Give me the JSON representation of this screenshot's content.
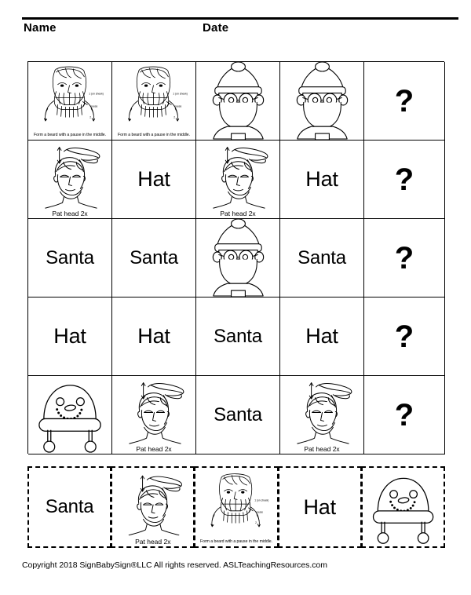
{
  "header": {
    "name_label": "Name",
    "date_label": "Date"
  },
  "icons": {
    "santa_sign": "santa-sign-illustration",
    "hat_sign": "hat-sign-illustration",
    "santa_picture": "santa-face-picture",
    "hat_picture": "hat-picture",
    "question": "question-mark"
  },
  "captions": {
    "santa_sign": "Form a beard with a pause in the middle.",
    "hat_sign": "Pat head 2x",
    "santa_sign_marks": {
      "one": "1 (on cheek)",
      "pause": "pause",
      "two": "2"
    }
  },
  "words": {
    "santa": "Santa",
    "hat": "Hat",
    "question": "?"
  },
  "grid": {
    "columns": 5,
    "rows": 5,
    "cells": [
      [
        {
          "type": "santa_sign",
          "text": ""
        },
        {
          "type": "santa_sign",
          "text": ""
        },
        {
          "type": "santa_picture",
          "text": ""
        },
        {
          "type": "santa_picture",
          "text": ""
        },
        {
          "type": "question",
          "text": "?"
        }
      ],
      [
        {
          "type": "hat_sign",
          "text": ""
        },
        {
          "type": "word",
          "text": "Hat"
        },
        {
          "type": "hat_sign",
          "text": ""
        },
        {
          "type": "word",
          "text": "Hat"
        },
        {
          "type": "question",
          "text": "?"
        }
      ],
      [
        {
          "type": "word",
          "text": "Santa"
        },
        {
          "type": "word",
          "text": "Santa"
        },
        {
          "type": "santa_picture",
          "text": ""
        },
        {
          "type": "word",
          "text": "Santa"
        },
        {
          "type": "question",
          "text": "?"
        }
      ],
      [
        {
          "type": "word",
          "text": "Hat"
        },
        {
          "type": "word",
          "text": "Hat"
        },
        {
          "type": "word",
          "text": "Santa"
        },
        {
          "type": "word",
          "text": "Hat"
        },
        {
          "type": "question",
          "text": "?"
        }
      ],
      [
        {
          "type": "hat_picture",
          "text": ""
        },
        {
          "type": "hat_sign",
          "text": ""
        },
        {
          "type": "word",
          "text": "Santa"
        },
        {
          "type": "hat_sign",
          "text": ""
        },
        {
          "type": "question",
          "text": "?"
        }
      ]
    ]
  },
  "cutouts": [
    {
      "type": "word",
      "text": "Santa"
    },
    {
      "type": "hat_sign",
      "text": ""
    },
    {
      "type": "santa_sign",
      "text": ""
    },
    {
      "type": "word",
      "text": "Hat"
    },
    {
      "type": "hat_picture",
      "text": ""
    }
  ],
  "footer": {
    "copyright": "Copyright 2018 SignBabySign®LLC All rights reserved.  ASLTeachingResources.com"
  }
}
